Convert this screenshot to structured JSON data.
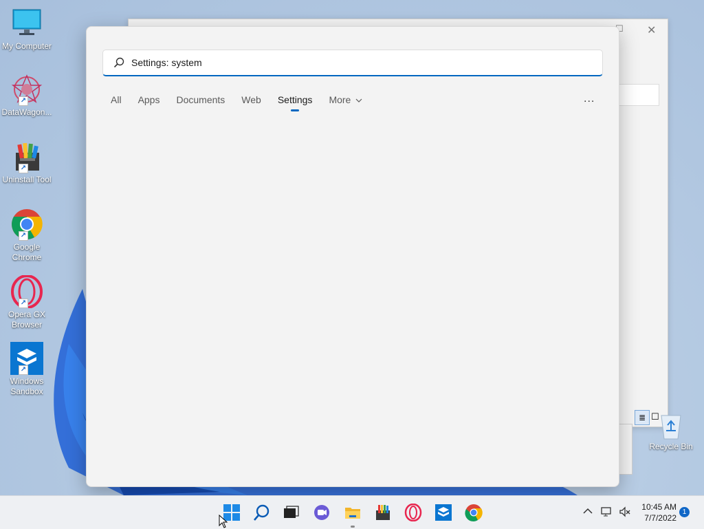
{
  "desktop": {
    "icons": [
      {
        "label": "My Computer"
      },
      {
        "label": "DataWagon..."
      },
      {
        "label": "Uninstall Tool"
      },
      {
        "label": "Google Chrome"
      },
      {
        "label": "Opera GX Browser"
      },
      {
        "label": "Windows Sandbox"
      }
    ],
    "recycle_bin_label": "Recycle Bin"
  },
  "search": {
    "query": "Settings: system",
    "tabs": [
      {
        "label": "All"
      },
      {
        "label": "Apps"
      },
      {
        "label": "Documents"
      },
      {
        "label": "Web"
      },
      {
        "label": "Settings",
        "active": true
      },
      {
        "label": "More"
      }
    ],
    "more_options_label": "..."
  },
  "taskbar": {
    "pinned": [
      "start-icon",
      "search-icon",
      "task-view-icon",
      "chat-icon",
      "file-explorer-icon",
      "uninstall-tool-icon",
      "opera-gx-icon",
      "windows-sandbox-icon",
      "chrome-icon"
    ],
    "clock": {
      "time": "10:45 AM",
      "date": "7/7/2022"
    },
    "notification_count": "1"
  },
  "colors": {
    "accent": "#0067c0"
  }
}
